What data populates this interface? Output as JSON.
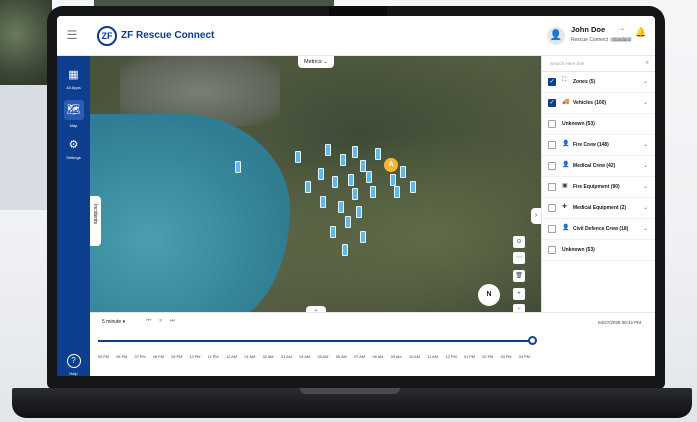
{
  "app": {
    "brand": "ZF Rescue Connect",
    "logo_text": "ZF"
  },
  "user": {
    "name": "John Doe",
    "subtitle": "Rescue Connect",
    "badge": "Standard"
  },
  "sidenav": [
    {
      "label": "All Apps",
      "icon": "grid-icon"
    },
    {
      "label": "Map",
      "icon": "map-icon"
    },
    {
      "label": "Settings",
      "icon": "gear-icon"
    },
    {
      "label": "Help",
      "icon": "help-icon"
    }
  ],
  "map": {
    "metrics_label": "Metrics",
    "incidents_label": "Incidents",
    "compass_label": "N",
    "zone_marker": "A"
  },
  "panel": {
    "search_placeholder": "Search Here Site",
    "rows": [
      {
        "label": "Zones (5)",
        "checked": true,
        "icon": "zones-icon",
        "chevron": true
      },
      {
        "label": "Vehicles (100)",
        "checked": true,
        "icon": "truck-icon",
        "chevron": true
      },
      {
        "label": "Unknown (53)",
        "checked": false,
        "icon": "",
        "chevron": false
      },
      {
        "label": "Fire Crew (148)",
        "checked": false,
        "icon": "person-icon",
        "chevron": true
      },
      {
        "label": "Medical Crew (42)",
        "checked": false,
        "icon": "person-icon",
        "chevron": true
      },
      {
        "label": "Fire Equipment (90)",
        "checked": false,
        "icon": "equipment-icon",
        "chevron": true
      },
      {
        "label": "Medical Equipment (2)",
        "checked": false,
        "icon": "medkit-icon",
        "chevron": true
      },
      {
        "label": "Civil Defence Crew (18)",
        "checked": false,
        "icon": "person-icon",
        "chevron": true
      },
      {
        "label": "Unknown (53)",
        "checked": false,
        "icon": "",
        "chevron": false
      }
    ]
  },
  "timeline": {
    "interval": "5 minute",
    "date": "04/27/2025 06:42 PM",
    "ticks": [
      "05 PM",
      "06 PM",
      "07 PM",
      "08 PM",
      "09 PM",
      "10 PM",
      "11 PM",
      "12 AM",
      "01 AM",
      "02 AM",
      "03 AM",
      "04 AM",
      "05 AM",
      "06 AM",
      "07 AM",
      "08 AM",
      "09 AM",
      "10 AM",
      "11 AM",
      "12 PM",
      "01 PM",
      "02 PM",
      "03 PM",
      "04 PM"
    ]
  },
  "colors": {
    "primary": "#0e3f8e",
    "vehicle": "#5fb8e8",
    "zone": "#f7b733"
  }
}
